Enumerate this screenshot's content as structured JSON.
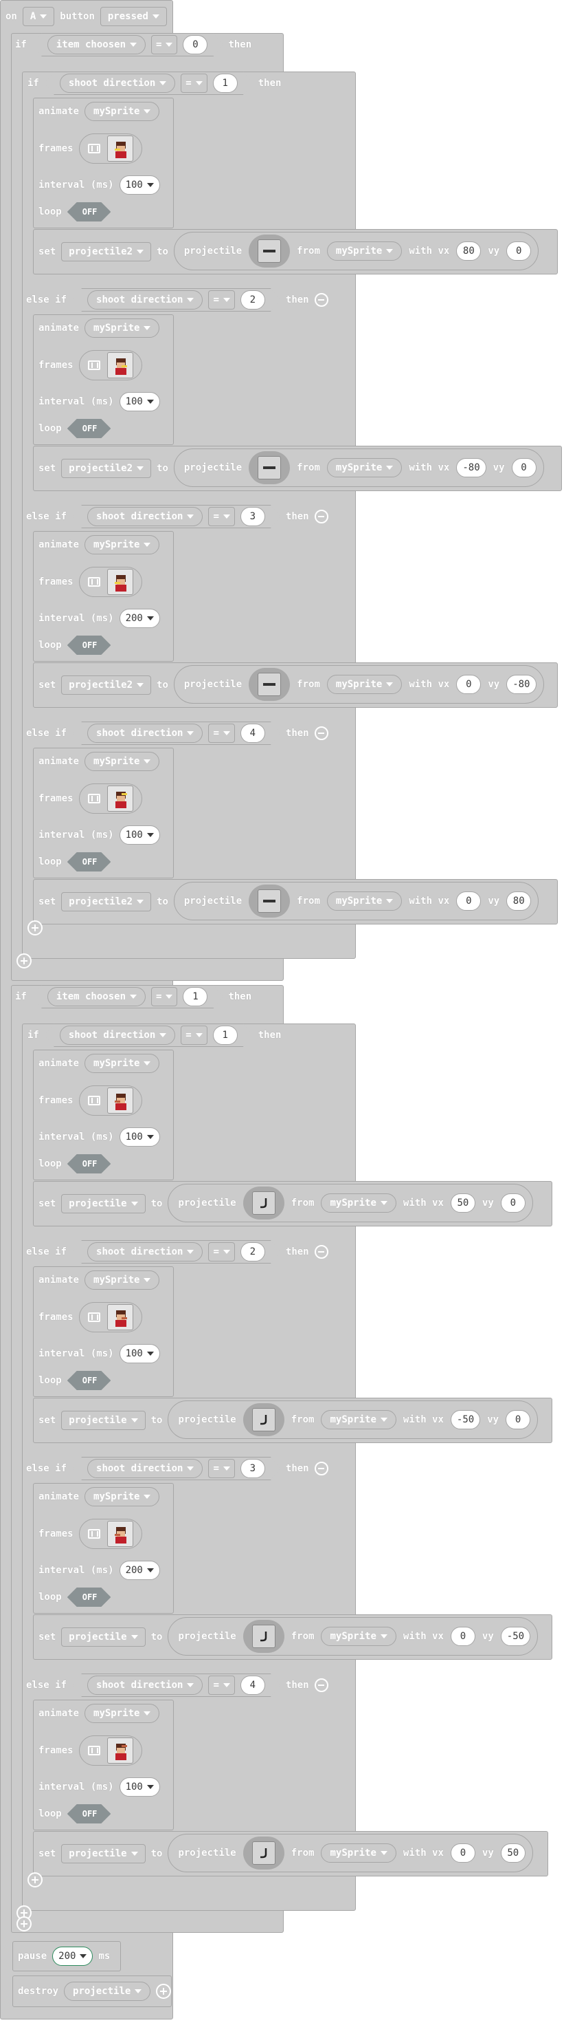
{
  "kw": {
    "on": "on",
    "button": "button",
    "if": "if",
    "then": "then",
    "else_if": "else if",
    "animate": "animate",
    "frames": "frames",
    "interval": "interval (ms)",
    "loop": "loop",
    "set": "set",
    "to": "to",
    "projectile": "projectile",
    "from": "from",
    "with_vx": "with vx",
    "vy": "vy",
    "pause": "pause",
    "ms": "ms",
    "destroy": "destroy"
  },
  "event": {
    "button": "A",
    "state": "pressed"
  },
  "blocks": [
    {
      "var": "item choosen",
      "op": "=",
      "value": "0",
      "projvar": "projectile2",
      "projimg": "dash",
      "branches": [
        {
          "dir": "1",
          "sprite": "mySprite",
          "interval": "100",
          "loop": "OFF",
          "vx": "80",
          "vy": "0"
        },
        {
          "dir": "2",
          "sprite": "mySprite",
          "interval": "100",
          "loop": "OFF",
          "vx": "-80",
          "vy": "0"
        },
        {
          "dir": "3",
          "sprite": "mySprite",
          "interval": "200",
          "loop": "OFF",
          "vx": "0",
          "vy": "-80"
        },
        {
          "dir": "4",
          "sprite": "mySprite",
          "interval": "100",
          "loop": "OFF",
          "vx": "0",
          "vy": "80"
        }
      ]
    },
    {
      "var": "item choosen",
      "op": "=",
      "value": "1",
      "projvar": "projectile",
      "projimg": "hook",
      "branches": [
        {
          "dir": "1",
          "sprite": "mySprite",
          "interval": "100",
          "loop": "OFF",
          "vx": "50",
          "vy": "0"
        },
        {
          "dir": "2",
          "sprite": "mySprite",
          "interval": "100",
          "loop": "OFF",
          "vx": "-50",
          "vy": "0"
        },
        {
          "dir": "3",
          "sprite": "mySprite",
          "interval": "200",
          "loop": "OFF",
          "vx": "0",
          "vy": "-50"
        },
        {
          "dir": "4",
          "sprite": "mySprite",
          "interval": "100",
          "loop": "OFF",
          "vx": "0",
          "vy": "50"
        }
      ]
    }
  ],
  "cond_var": "shoot direction",
  "pause": {
    "value": "200"
  },
  "destroy": {
    "target": "projectile"
  },
  "colors": {
    "block": "#cbcbcb",
    "border": "#a6a6a6",
    "toggle": "#8a9294"
  }
}
